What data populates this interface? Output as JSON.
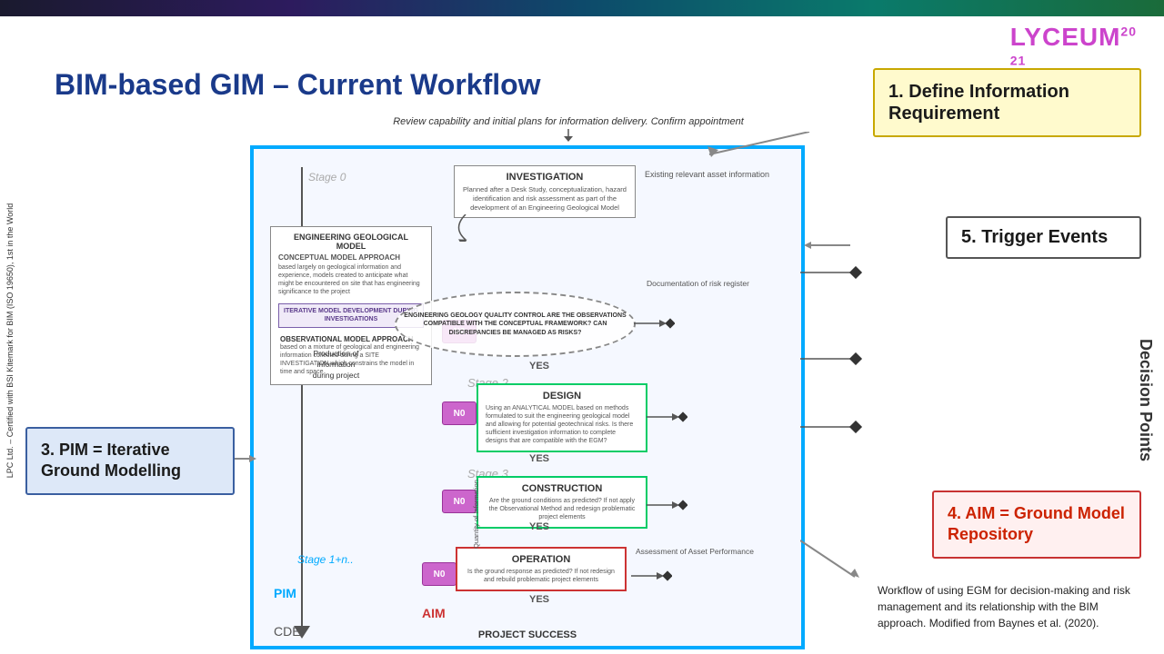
{
  "topbar": {},
  "logo": {
    "text": "LYCEUM",
    "year": "20\n21"
  },
  "left_text": "LPC Ltd. – Certified with BSI Kitemark for BIM (ISO 19650), 1st in the World",
  "main_title": "BIM-based GIM – Current Workflow",
  "caption_above": "Review capability and initial plans for information delivery.\nConfirm appointment",
  "box1": {
    "number": "1.",
    "title": "Define Information\nRequirement"
  },
  "box3": {
    "number": "3.",
    "title": "PIM = Iterative\nGround Modelling"
  },
  "box4": {
    "number": "4.",
    "title": "AIM = Ground\nModel Repository"
  },
  "box5": {
    "number": "5.",
    "title": "Trigger Events"
  },
  "decision_points_label": "Decision Points",
  "workflow": {
    "investigation": {
      "title": "INVESTIGATION",
      "desc": "Planned after a Desk Study, conceptualization, hazard identification and risk assessment as part of the development of an Engineering Geological Model"
    },
    "existing_info": "Existing\nrelevant asset\ninformation",
    "egm": {
      "title": "ENGINEERING GEOLOGICAL MODEL",
      "subtitle": "CONCEPTUAL MODEL APPROACH",
      "desc": "based largely on geological information and experience, models created to anticipate what might be encountered on site that has engineering significance to the project",
      "iter_title": "ITERATIVE MODEL\nDEVELOPMENT DURING\nINVESTIGATIONS",
      "obs_title": "OBSERVATIONAL MODEL APPROACH",
      "obs_desc": "based on a mixture of geological and engineering information collected during a SITE INVESTIGATION which constrains the model in time and space"
    },
    "qc": {
      "text": "ENGINEERING GEOLOGY QUALITY CONTROL\nARE THE OBSERVATIONS COMPATIBLE\nWITH THE CONCEPTUAL FRAMEWORK?\nCAN DISCREPANCIES BE MANAGED AS RISKS?"
    },
    "design": {
      "title": "DESIGN",
      "desc": "Using an ANALYTICAL MODEL based on methods formulated to suit the engineering geological model and allowing for potential geotechnical risks. Is there sufficient investigation information to complete designs that are compatible with the EGM?"
    },
    "construction": {
      "title": "CONSTRUCTION",
      "desc": "Are the ground conditions as predicted? If not apply the Observational Method and redesign problematic project elements"
    },
    "operation": {
      "title": "OPERATION",
      "desc": "Is the ground response as predicted? If not redesign and rebuild problematic project elements"
    },
    "pim_label": "PIM",
    "aim_label": "AIM",
    "cde_label": "CDE",
    "project_success": "PROJECT SUCCESS",
    "stage0": "Stage 0",
    "stage2": "Stage 2",
    "stage3": "Stage 3",
    "stage1n": "Stage 1+n..",
    "doc_risk": "Documentation\nof risk register",
    "assessment": "Assessment of\nAsset\nPerformance",
    "production_label": "Production of\ninformation\nduring project",
    "quantity_label": "Quantity of\nInformation"
  },
  "bottom_desc": "Workflow of using EGM for decision-making and risk management and its relationship with the BIM approach. Modified from Baynes et al. (2020)."
}
